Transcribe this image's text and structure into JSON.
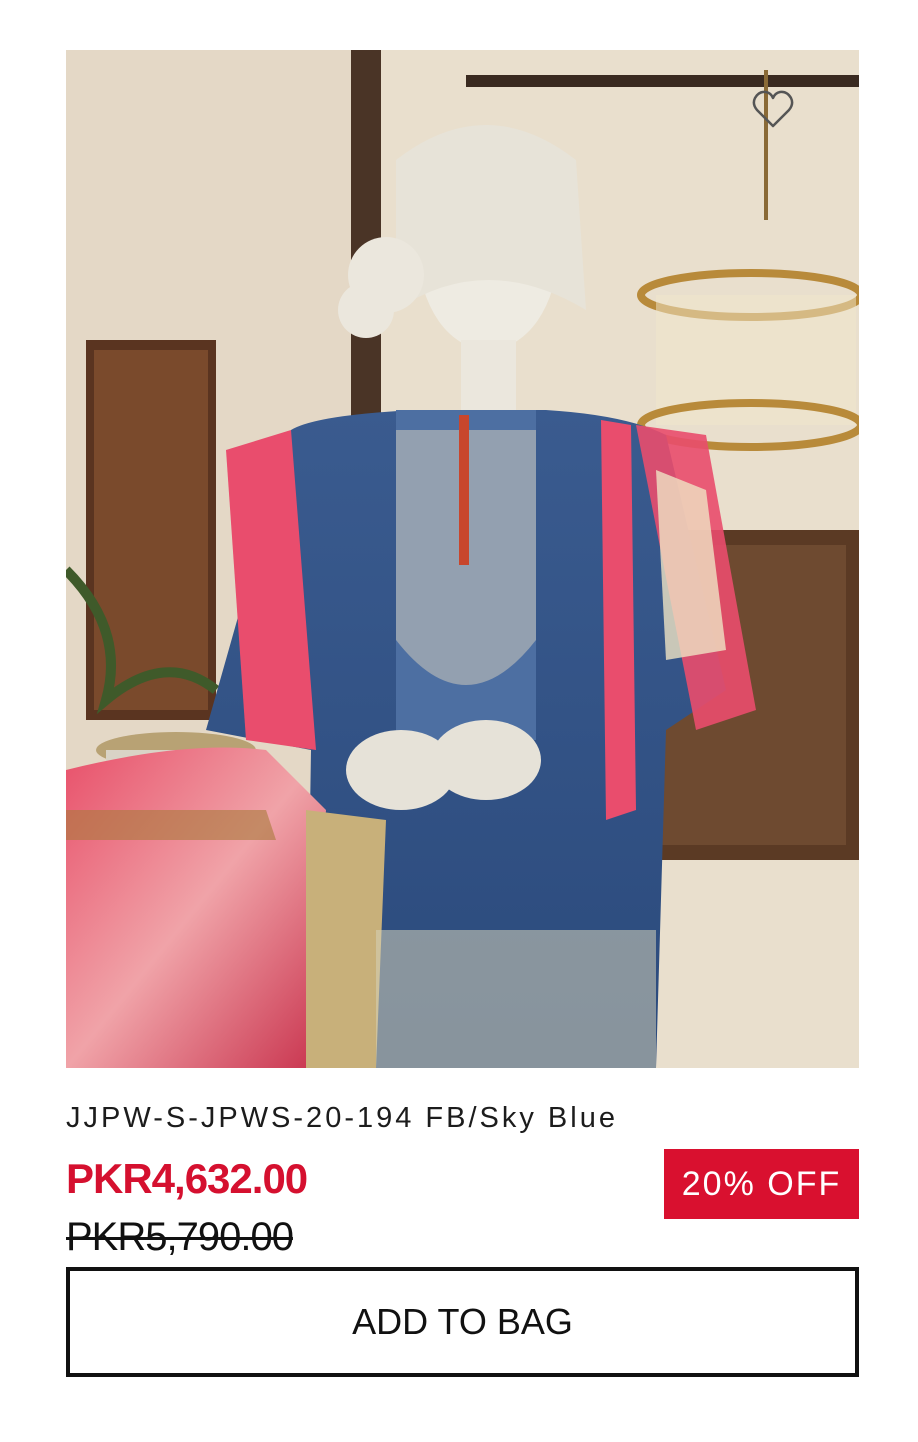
{
  "product": {
    "image_alt": "Mannequin wearing embroidered sky blue suit",
    "wishlist_icon": "heart-outline-icon",
    "title": "JJPW-S-JPWS-20-194 FB/Sky Blue",
    "sale_price": "PKR4,632.00",
    "original_price": "PKR5,790.00",
    "discount_badge": "20% OFF",
    "add_to_bag_label": "ADD TO BAG"
  },
  "colors": {
    "sale_price": "#d5102f",
    "badge_background": "#d9102f",
    "badge_text": "#ffffff",
    "button_border": "#111111",
    "text": "#1c1c1c"
  }
}
